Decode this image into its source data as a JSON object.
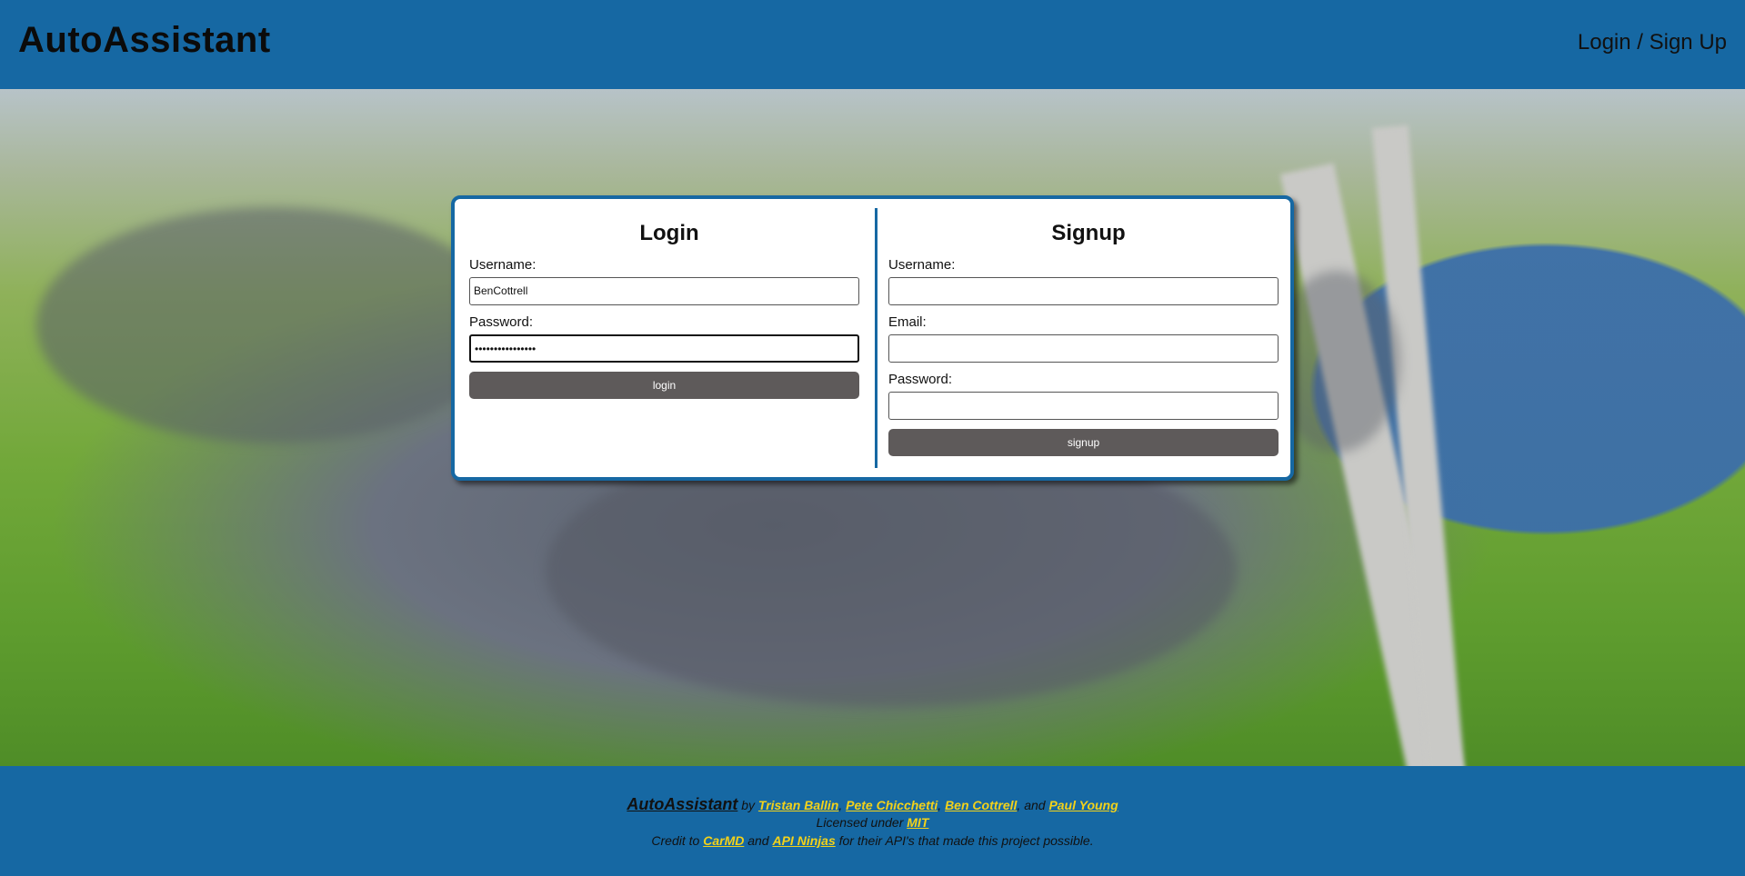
{
  "header": {
    "brand": "AutoAssistant",
    "nav_link": "Login / Sign Up"
  },
  "login": {
    "title": "Login",
    "username_label": "Username:",
    "username_value": "BenCottrell",
    "password_label": "Password:",
    "password_value": "••••••••••••••••",
    "button": "login"
  },
  "signup": {
    "title": "Signup",
    "username_label": "Username:",
    "email_label": "Email:",
    "password_label": "Password:",
    "button": "signup"
  },
  "footer": {
    "brand": "AutoAssistant",
    "by": "by",
    "authors": [
      "Tristan Ballin",
      "Pete Chicchetti",
      "Ben Cottrell",
      "Paul Young"
    ],
    "and": "and",
    "license_prefix": "Licensed under",
    "license": "MIT",
    "credit_prefix": "Credit to",
    "credit_1": "CarMD",
    "credit_and": "and",
    "credit_2": "API Ninjas",
    "credit_suffix": "for their API's that made this project possible."
  },
  "colors": {
    "brand_blue": "#1668a3",
    "button_gray": "#5e5a5a",
    "link_yellow": "#f3d21a"
  }
}
